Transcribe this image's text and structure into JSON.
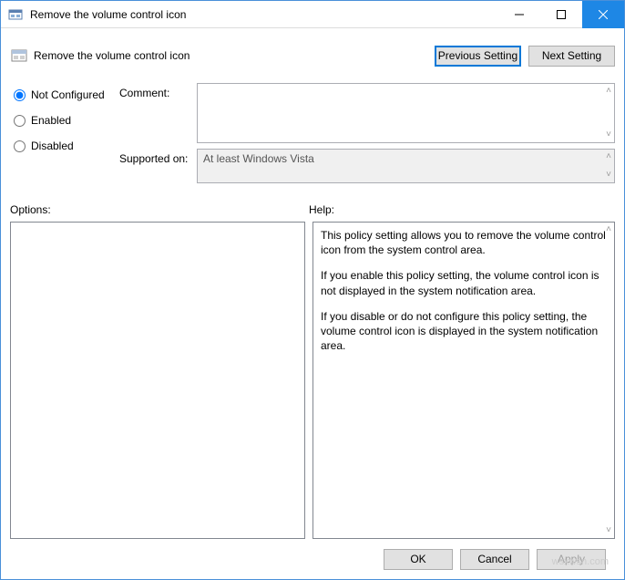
{
  "window": {
    "title": "Remove the volume control icon"
  },
  "header": {
    "title": "Remove the volume control icon",
    "prev_btn": "Previous Setting",
    "next_btn": "Next Setting"
  },
  "radios": {
    "not_configured": "Not Configured",
    "enabled": "Enabled",
    "disabled": "Disabled",
    "selected": "not_configured"
  },
  "meta": {
    "comment_label": "Comment:",
    "comment_value": "",
    "supported_label": "Supported on:",
    "supported_value": "At least Windows Vista"
  },
  "panels": {
    "options_label": "Options:",
    "help_label": "Help:",
    "help_p1": "This policy setting allows you to remove the volume control icon from the system control area.",
    "help_p2": "If you enable this policy setting, the volume control icon is not displayed in the system notification area.",
    "help_p3": "If you disable or do not configure this policy setting, the volume control icon is displayed in the system notification area."
  },
  "footer": {
    "ok": "OK",
    "cancel": "Cancel",
    "apply": "Apply"
  },
  "watermark": "wsxwsn.com"
}
